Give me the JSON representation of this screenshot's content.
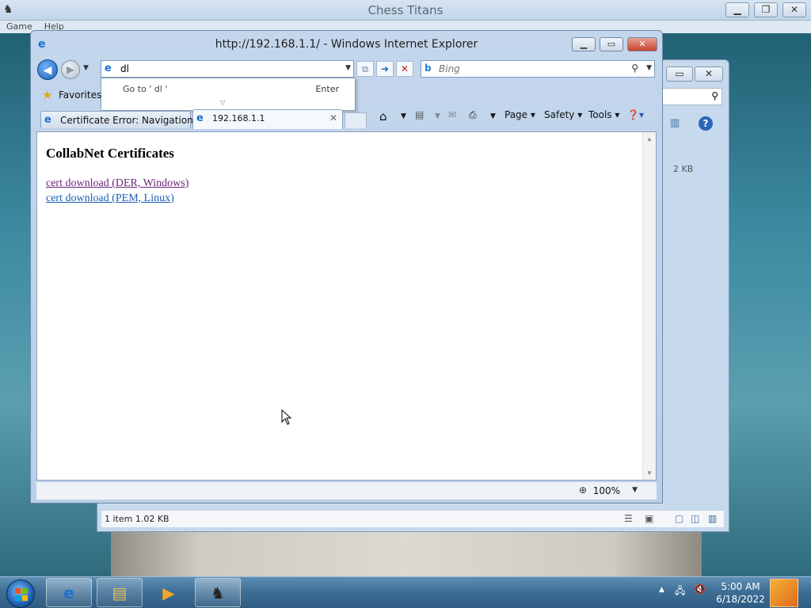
{
  "chess": {
    "title": "Chess Titans",
    "menu": [
      "Game",
      "Help"
    ],
    "min_glyph": "▁",
    "max_glyph": "❐",
    "close_glyph": "✕"
  },
  "explorer": {
    "size_text": "2 KB",
    "status_text": "1 item  1.02 KB"
  },
  "ie": {
    "title": "http://192.168.1.1/ - Windows Internet Explorer",
    "address_value": "dl",
    "search_placeholder": "Bing",
    "autocomplete_goto": "Go to ' dl '",
    "autocomplete_enter": "Enter",
    "favorites_label": "Favorites",
    "tabs": [
      {
        "label": "Certificate Error: Navigation ..."
      },
      {
        "label": "192.168.1.1"
      }
    ],
    "commands": {
      "page": "Page ▾",
      "safety": "Safety ▾",
      "tools": "Tools ▾"
    },
    "zoom": "100%",
    "page": {
      "heading": "CollabNet Certificates",
      "links": [
        "cert download (DER, Windows)",
        "cert download (PEM, Linux)"
      ]
    }
  },
  "taskbar": {
    "time": "5:00 AM",
    "date": "6/18/2022"
  }
}
